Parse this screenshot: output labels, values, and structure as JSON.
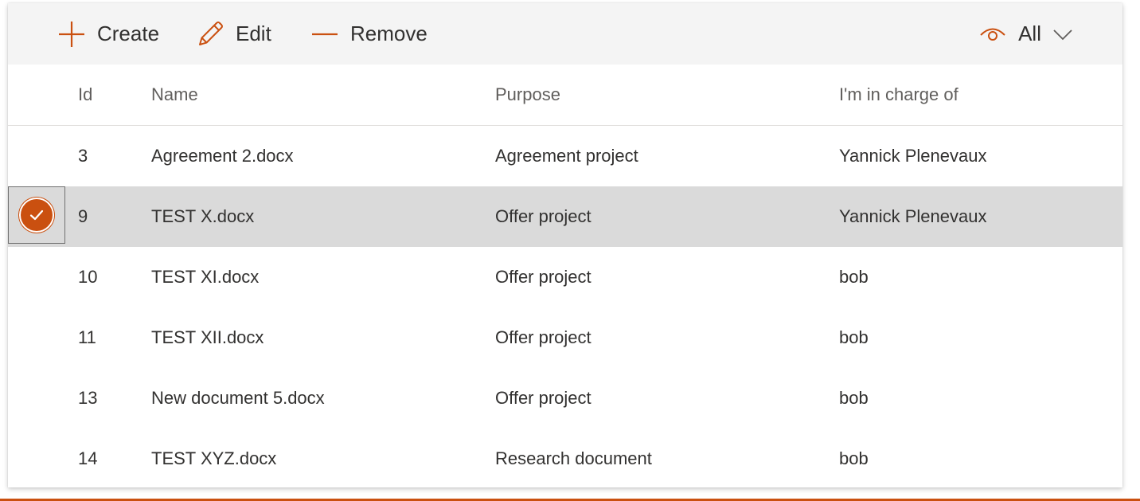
{
  "colors": {
    "accent": "#ca5010",
    "selected_row": "#dadada",
    "toolbar_bg": "#f4f4f4"
  },
  "toolbar": {
    "create_label": "Create",
    "create_icon": "plus-icon",
    "edit_label": "Edit",
    "edit_icon": "pencil-icon",
    "remove_label": "Remove",
    "remove_icon": "minus-icon",
    "view_label": "All",
    "view_icon": "eye-icon",
    "view_dropdown_icon": "chevron-down-icon"
  },
  "table": {
    "columns": [
      "Id",
      "Name",
      "Purpose",
      "I'm in charge of"
    ],
    "rows": [
      {
        "id": "3",
        "name": "Agreement 2.docx",
        "purpose": "Agreement project",
        "owner": "Yannick Plenevaux",
        "selected": false
      },
      {
        "id": "9",
        "name": "TEST X.docx",
        "purpose": "Offer project",
        "owner": "Yannick Plenevaux",
        "selected": true
      },
      {
        "id": "10",
        "name": "TEST XI.docx",
        "purpose": "Offer project",
        "owner": "bob",
        "selected": false
      },
      {
        "id": "11",
        "name": "TEST XII.docx",
        "purpose": "Offer project",
        "owner": "bob",
        "selected": false
      },
      {
        "id": "13",
        "name": "New document 5.docx",
        "purpose": "Offer project",
        "owner": "bob",
        "selected": false
      },
      {
        "id": "14",
        "name": "TEST XYZ.docx",
        "purpose": "Research document",
        "owner": "bob",
        "selected": false
      }
    ]
  }
}
